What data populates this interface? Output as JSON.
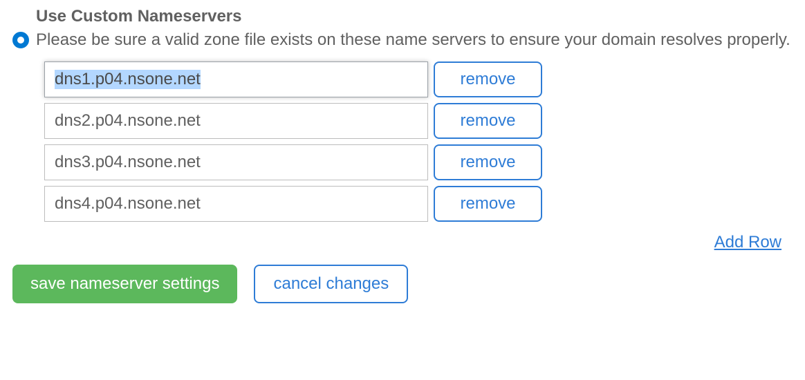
{
  "heading": "Use Custom Nameservers",
  "description": "Please be sure a valid zone file exists on these name servers to ensure your domain resolves properly.",
  "nameservers": [
    {
      "value": "dns1.p04.nsone.net",
      "selected": true
    },
    {
      "value": "dns2.p04.nsone.net",
      "selected": false
    },
    {
      "value": "dns3.p04.nsone.net",
      "selected": false
    },
    {
      "value": "dns4.p04.nsone.net",
      "selected": false
    }
  ],
  "buttons": {
    "remove": "remove",
    "add_row": "Add Row",
    "save": "save nameserver settings",
    "cancel": "cancel changes"
  }
}
